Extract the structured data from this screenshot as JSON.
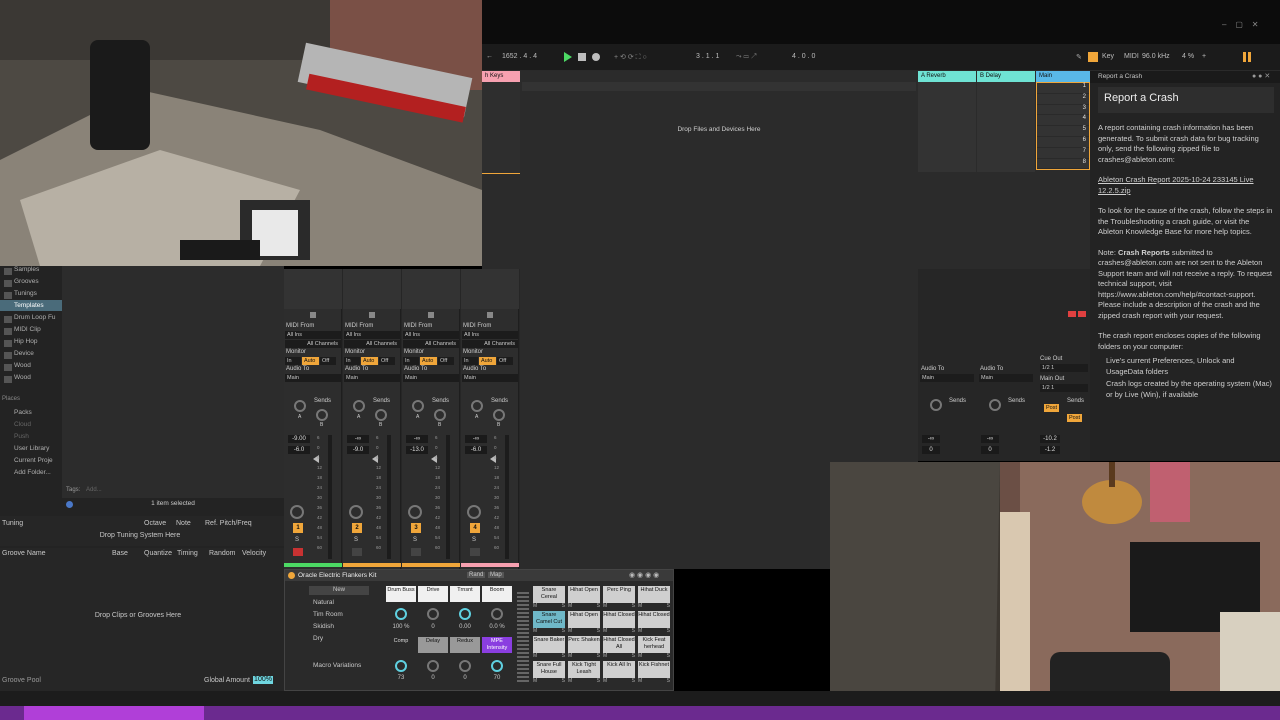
{
  "transport": {
    "tempo": "1652 . 4 . 4",
    "position": "3 . 1 . 1",
    "loop_end": "4 . 0 . 0",
    "key_label": "Key",
    "midi_label": "MIDI",
    "sample_rate": "96.0 kHz",
    "cpu": "4 %"
  },
  "session": {
    "track_partial": "h Keys",
    "drop_hint": "Drop Files and Devices Here",
    "returns": [
      "A Reverb",
      "B Delay"
    ],
    "main": "Main",
    "scene_numbers": [
      "1",
      "2",
      "3",
      "4",
      "5",
      "6",
      "7",
      "8"
    ]
  },
  "browser": {
    "items": [
      "Samples",
      "Grooves",
      "Tunings",
      "Templates",
      "Drum Loop Fu",
      "MIDI Clip",
      "Hip Hop",
      "Device",
      "Wood",
      "Wood"
    ],
    "places_label": "Places",
    "places": [
      "Packs",
      "Cloud",
      "Push",
      "User Library",
      "Current Proje",
      "Add Folder..."
    ],
    "tags_label": "Tags:",
    "tags_placeholder": "Add...",
    "selection": "1 item selected",
    "tuning_header": "Tuning",
    "tuning_cols": [
      "Octave",
      "Note",
      "Ref. Pitch/Freq"
    ],
    "tuning_drop": "Drop Tuning System Here",
    "groove_cols": [
      "Groove Name",
      "Base",
      "Quantize",
      "Timing",
      "Random",
      "Velocity"
    ],
    "groove_drop": "Drop Clips or Grooves Here",
    "groove_pool": "Groove Pool",
    "global_amount_label": "Global Amount",
    "global_amount": "100%"
  },
  "mixer": {
    "midi_from": "MIDI From",
    "all_ins": "All Ins",
    "all_channels": "All Channels",
    "monitor": "Monitor",
    "monitor_opts": [
      "In",
      "Auto",
      "Off"
    ],
    "audio_to": "Audio To",
    "main": "Main",
    "sends": "Sends",
    "send_a": "A",
    "send_b": "B",
    "solo": "S",
    "tracks": [
      {
        "number": "1",
        "volume": "-9.00",
        "peak": "-6.0"
      },
      {
        "number": "2",
        "volume": "-∞",
        "peak": "-9.0"
      },
      {
        "number": "3",
        "volume": "-∞",
        "peak": "-13.0"
      },
      {
        "number": "4",
        "volume": "-∞",
        "peak": "-6.0"
      }
    ],
    "db_scale": [
      "6",
      "0",
      "6",
      "12",
      "18",
      "24",
      "30",
      "36",
      "42",
      "48",
      "54",
      "60"
    ]
  },
  "returns": {
    "audio_to": "Audio To",
    "main": "Main",
    "sends": "Sends",
    "cue_out_label": "Cue Out",
    "cue_out": "1/2 1",
    "main_out_label": "Main Out",
    "main_out": "1/2 1",
    "post": "Post",
    "strips": [
      {
        "volume": "-∞",
        "peak": "0"
      },
      {
        "volume": "-∞",
        "peak": "0"
      },
      {
        "volume": "-10.2",
        "peak": "-1.2"
      }
    ]
  },
  "crash": {
    "panel_title": "Report a Crash",
    "heading": "Report a Crash",
    "p1": "A report containing crash information has been generated. To submit crash data for bug tracking only, send the following zipped file to crashes@ableton.com:",
    "file_link": "Ableton Crash Report 2025-10-24 233145 Live 12.2.5.zip",
    "p2": "To look for the cause of the crash, follow the steps in the Troubleshooting a crash guide, or visit the Ableton Knowledge Base for more help topics.",
    "p3_bold": "Crash Reports",
    "p3_pre": "Note:",
    "p3": "submitted to crashes@ableton.com are not sent to the Ableton Support team and will not receive a reply. To request technical support, visit https://www.ableton.com/help/#contact-support. Please include a description of the crash and the zipped crash report with your request.",
    "p4": "The crash report encloses copies of the following folders on your computer:",
    "bullet1": "Live's current Preferences, Unlock and UsageData folders",
    "bullet2": "Crash logs created by the operating system (Mac) or by Live (Win), if available"
  },
  "device": {
    "name": "Oracle Electric Flankers Kit",
    "rand": "Rand",
    "map": "Map",
    "new": "New",
    "variations": [
      "Natural",
      "Tim Room",
      "Skidish",
      "Dry"
    ],
    "macro_variations": "Macro Variations",
    "macros_row1": [
      "Drum Buss",
      "Drive",
      "Trnsnt",
      "Boom"
    ],
    "macros_row1_vals": [
      "100 %",
      "0",
      "0.00",
      "0.0 %"
    ],
    "macros_row2": [
      "Comp",
      "Delay",
      "Redux",
      "MPE Intensity"
    ],
    "macros_row2_vals": [
      "73",
      "0",
      "0",
      "70"
    ],
    "pads": [
      "Snare Cereal",
      "Hihat Open",
      "Perc Ping",
      "Hihat Duck",
      "Snare Camel Cut",
      "Hihat Open",
      "Hihat Closed",
      "Hihat Closed",
      "Snare Baker",
      "Perc Shaken",
      "Hihat Closed All",
      "Kick Feat herhead",
      "Snare Full House",
      "Kick Tight Leash",
      "Kick All In",
      "Kick Fishnet"
    ],
    "pad_buttons": [
      "M",
      "S"
    ]
  }
}
